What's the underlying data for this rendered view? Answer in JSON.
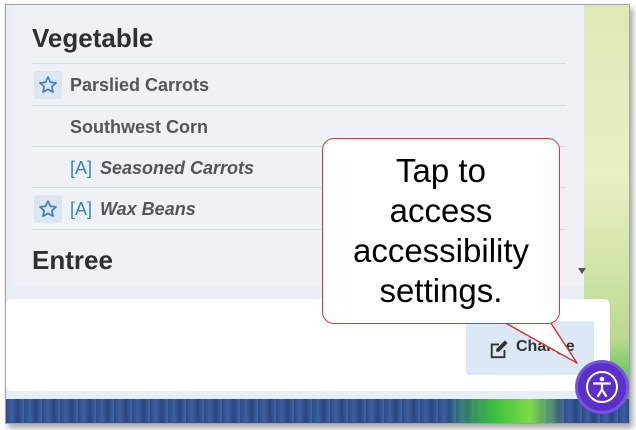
{
  "menu": {
    "sections": [
      {
        "title": "Vegetable",
        "items": [
          {
            "label": "Parslied Carrots",
            "favorite": true,
            "allergen_flag": ""
          },
          {
            "label": "Southwest Corn",
            "favorite": false,
            "allergen_flag": ""
          },
          {
            "label": "Seasoned Carrots",
            "favorite": false,
            "allergen_flag": "[A]"
          },
          {
            "label": "Wax Beans",
            "favorite": true,
            "allergen_flag": "[A]"
          }
        ]
      },
      {
        "title": "Entree",
        "items": []
      }
    ]
  },
  "card": {
    "change_label": "Change"
  },
  "callout": {
    "lines": [
      "Tap to",
      "access",
      "accessibility",
      "settings."
    ]
  },
  "icons": {
    "favorite": "star-outline-icon",
    "edit": "pencil-square-icon",
    "accessibility": "accessibility-person-icon",
    "scroll_down": "caret-down-icon"
  },
  "colors": {
    "star_blue": "#3d7fc4",
    "callout_border": "#cf3a3a",
    "a11y_button": "#5b2fc9",
    "change_button_bg": "#dbe8f6"
  }
}
